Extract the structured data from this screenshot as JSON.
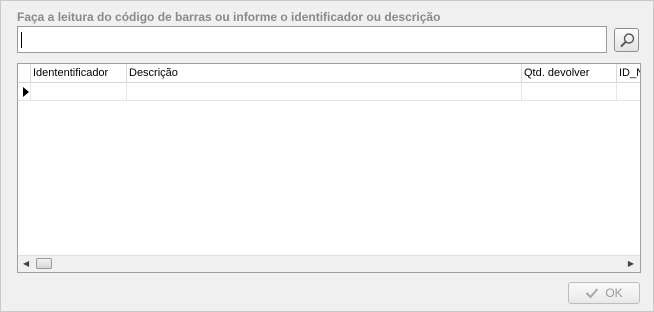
{
  "prompt": "Faça a leitura do código de barras ou informe o identificador ou descrição",
  "search": {
    "value": ""
  },
  "grid": {
    "columns": [
      "Idententificador",
      "Descrição",
      "Qtd. devolver",
      "ID_N"
    ],
    "rows": [
      [
        "",
        "",
        "",
        ""
      ]
    ]
  },
  "icons": {
    "search": "magnifier-icon",
    "ok": "checkmark-icon",
    "row_indicator": "triangle-right-icon",
    "scroll_left": "arrow-left-icon",
    "scroll_right": "arrow-right-icon"
  },
  "buttons": {
    "ok_label": "OK"
  }
}
